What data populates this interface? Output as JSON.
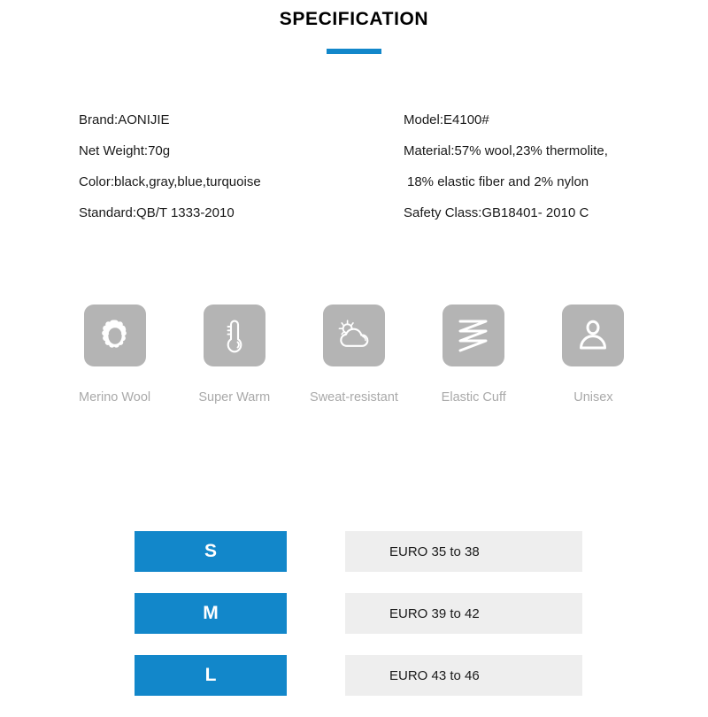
{
  "header": {
    "title": "SPECIFICATION",
    "accent_color": "#1287ca"
  },
  "specs": {
    "left": [
      "Brand:AONIJIE",
      "Net Weight:70g",
      "Color:black,gray,blue,turquoise",
      "Standard:QB/T 1333-2010"
    ],
    "right": [
      "Model:E4100#",
      "Material:57% wool,23% thermolite,",
      "18% elastic fiber and 2% nylon",
      "Safety Class:GB18401- 2010 C"
    ]
  },
  "features": [
    {
      "icon": "sheep-icon",
      "label": "Merino Wool"
    },
    {
      "icon": "thermometer-icon",
      "label": "Super Warm"
    },
    {
      "icon": "sun-cloud-icon",
      "label": "Sweat-resistant"
    },
    {
      "icon": "zigzag-icon",
      "label": "Elastic Cuff"
    },
    {
      "icon": "person-icon",
      "label": "Unisex"
    }
  ],
  "feature_style": {
    "tile_color": "#b4b4b4",
    "label_color": "#a9a9a9"
  },
  "sizes": {
    "badge_color": "#1287ca",
    "value_bg_color": "#eeeeee",
    "rows": [
      {
        "size": "S",
        "range": "EURO 35 to 38"
      },
      {
        "size": "M",
        "range": "EURO 39 to 42"
      },
      {
        "size": "L",
        "range": "EURO 43 to 46"
      }
    ]
  }
}
